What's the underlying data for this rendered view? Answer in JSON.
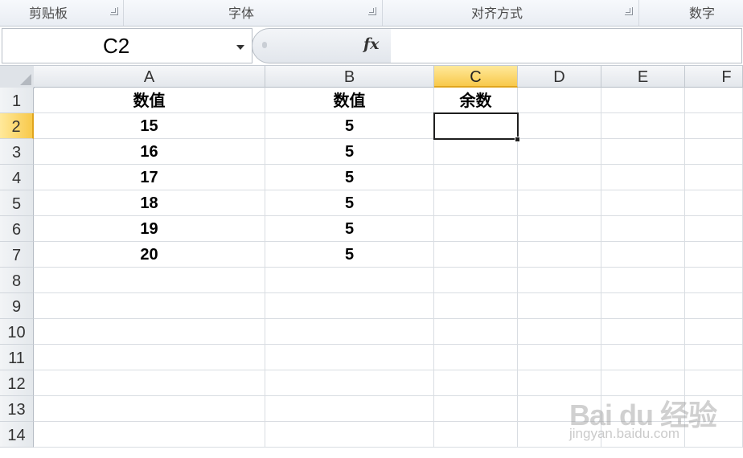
{
  "ribbon": {
    "groups": [
      {
        "label": "剪贴板"
      },
      {
        "label": "字体"
      },
      {
        "label": "对齐方式"
      },
      {
        "label": "数字"
      }
    ]
  },
  "formula_bar": {
    "name_box": "C2",
    "fx_label": "fx",
    "formula": ""
  },
  "sheet": {
    "columns": [
      "A",
      "B",
      "C",
      "D",
      "E",
      "F"
    ],
    "rows": [
      "1",
      "2",
      "3",
      "4",
      "5",
      "6",
      "7",
      "8",
      "9",
      "10",
      "11",
      "12",
      "13",
      "14"
    ],
    "selected_cell": "C2",
    "cells": {
      "A1": "数值",
      "B1": "数值",
      "C1": "余数",
      "A2": "15",
      "B2": "5",
      "A3": "16",
      "B3": "5",
      "A4": "17",
      "B4": "5",
      "A5": "18",
      "B5": "5",
      "A6": "19",
      "B6": "5",
      "A7": "20",
      "B7": "5"
    }
  },
  "watermark": {
    "brand": "Bai du 经验",
    "url": "jingyan.baidu.com"
  },
  "colors": {
    "selection_header": "#f8c94b",
    "active_border": "#1e1e1e",
    "gridline": "#d9dde2"
  }
}
